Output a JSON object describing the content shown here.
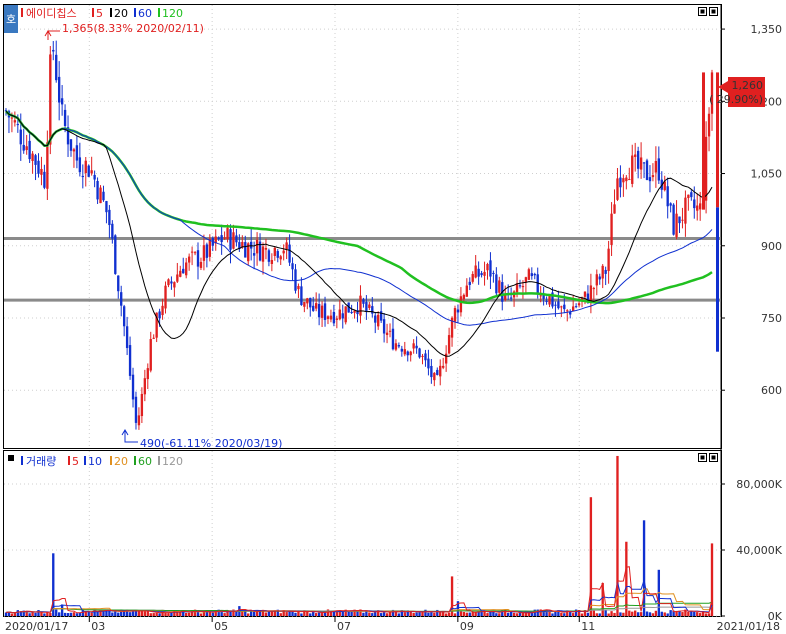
{
  "stock_name": "에이디칩스",
  "icon_label": "호",
  "legend": {
    "price_periods": [
      "5",
      "20",
      "60",
      "120"
    ],
    "price_colors": [
      "#e02020",
      "#000000",
      "#1030d0",
      "#20c020"
    ],
    "volume_title": "거래량",
    "volume_periods": [
      "5",
      "10",
      "20",
      "60",
      "120"
    ],
    "volume_colors": [
      "#e02020",
      "#1030d0",
      "#e09020",
      "#20a020",
      "#999999"
    ]
  },
  "annotations": {
    "high": "1,365(8.33% 2020/02/11)",
    "low": "490(-61.11% 2020/03/19)"
  },
  "last_price_label": "1,260",
  "last_change_label": "( 29.90%)",
  "date_start_label": "2020/01/17",
  "date_end_label": "2021/01/18",
  "chart_data": [
    {
      "type": "candlestick",
      "title": "에이디칩스",
      "yticks": [
        600,
        750,
        900,
        1050,
        1200,
        1350
      ],
      "ytick_labels": [
        "600",
        "750",
        "900",
        "1,050",
        "1,200",
        "1,350"
      ],
      "ylim": [
        480,
        1400
      ],
      "xticks": [
        "03",
        "05",
        "07",
        "09",
        "11"
      ],
      "horizontal_lines": [
        915,
        787
      ],
      "high": {
        "value": 1365,
        "date": "2020/02/11"
      },
      "low": {
        "value": 490,
        "date": "2020/03/19"
      },
      "last": {
        "value": 1260,
        "change_pct": 29.9
      },
      "close_path": [
        {
          "t": 0,
          "close": 1180
        },
        {
          "t": 0.03,
          "close": 1110
        },
        {
          "t": 0.055,
          "close": 1040
        },
        {
          "t": 0.065,
          "close": 1330
        },
        {
          "t": 0.08,
          "close": 1160
        },
        {
          "t": 0.1,
          "close": 1080
        },
        {
          "t": 0.12,
          "close": 1060
        },
        {
          "t": 0.145,
          "close": 960
        },
        {
          "t": 0.165,
          "close": 760
        },
        {
          "t": 0.185,
          "close": 520
        },
        {
          "t": 0.205,
          "close": 700
        },
        {
          "t": 0.225,
          "close": 800
        },
        {
          "t": 0.25,
          "close": 860
        },
        {
          "t": 0.28,
          "close": 880
        },
        {
          "t": 0.31,
          "close": 920
        },
        {
          "t": 0.34,
          "close": 900
        },
        {
          "t": 0.37,
          "close": 890
        },
        {
          "t": 0.395,
          "close": 900
        },
        {
          "t": 0.415,
          "close": 800
        },
        {
          "t": 0.44,
          "close": 760
        },
        {
          "t": 0.47,
          "close": 760
        },
        {
          "t": 0.5,
          "close": 780
        },
        {
          "t": 0.52,
          "close": 750
        },
        {
          "t": 0.55,
          "close": 700
        },
        {
          "t": 0.585,
          "close": 680
        },
        {
          "t": 0.61,
          "close": 610
        },
        {
          "t": 0.635,
          "close": 760
        },
        {
          "t": 0.655,
          "close": 830
        },
        {
          "t": 0.685,
          "close": 850
        },
        {
          "t": 0.71,
          "close": 780
        },
        {
          "t": 0.74,
          "close": 830
        },
        {
          "t": 0.77,
          "close": 790
        },
        {
          "t": 0.79,
          "close": 760
        },
        {
          "t": 0.82,
          "close": 790
        },
        {
          "t": 0.85,
          "close": 850
        },
        {
          "t": 0.865,
          "close": 1040
        },
        {
          "t": 0.88,
          "close": 1070
        },
        {
          "t": 0.905,
          "close": 1050
        },
        {
          "t": 0.925,
          "close": 1060
        },
        {
          "t": 0.945,
          "close": 940
        },
        {
          "t": 0.965,
          "close": 980
        },
        {
          "t": 0.985,
          "close": 975
        },
        {
          "t": 1.0,
          "close": 1260
        }
      ]
    },
    {
      "type": "bar",
      "title": "거래량",
      "yticks": [
        0,
        40000,
        80000
      ],
      "ytick_labels": [
        "0K",
        "40,000K",
        "80,000K"
      ],
      "ylim": [
        0,
        100000
      ],
      "spikes": [
        {
          "t": 0.065,
          "value": 38000
        },
        {
          "t": 0.08,
          "value": 7000
        },
        {
          "t": 0.2,
          "value": 3000
        },
        {
          "t": 0.33,
          "value": 6000
        },
        {
          "t": 0.63,
          "value": 24000
        },
        {
          "t": 0.64,
          "value": 9000
        },
        {
          "t": 0.83,
          "value": 72000
        },
        {
          "t": 0.845,
          "value": 20000
        },
        {
          "t": 0.865,
          "value": 97000
        },
        {
          "t": 0.88,
          "value": 45000
        },
        {
          "t": 0.905,
          "value": 58000
        },
        {
          "t": 0.925,
          "value": 28000
        },
        {
          "t": 1.0,
          "value": 44000
        }
      ]
    }
  ]
}
